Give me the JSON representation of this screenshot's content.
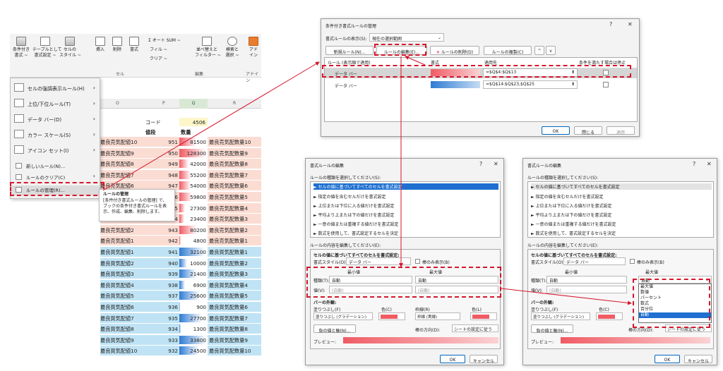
{
  "ribbon": {
    "btn_conditional": "条件付き\n書式 ~",
    "btn_table": "テーブルとして\n書式設定 ~",
    "btn_cellstyle": "セルの\nスタイル ~",
    "btn_insert": "挿入",
    "btn_delete": "削除",
    "btn_format": "書式",
    "autosum": "Σ オート SUM ~",
    "fill": "フィル ~",
    "clear": "クリア ~",
    "sort": "並べ替えと\nフィルター ~",
    "find": "検索と\n選択 ~",
    "addin": "アド\nイン",
    "group_cell": "セル",
    "group_edit": "編集",
    "group_addin": "アドイン"
  },
  "columns": [
    "O",
    "P",
    "Q",
    "R"
  ],
  "header_row": {
    "code_label": "コード",
    "code_value": "4506",
    "price_label": "値段",
    "qty_label": "数量"
  },
  "rows": [
    {
      "name": "最良売気配値10",
      "price": "951",
      "qty": "81500",
      "qty_pct": 0.62,
      "label": "最良売気配数量10",
      "side": "sell"
    },
    {
      "name": "最良売気配値9",
      "price": "950",
      "qty": "128300",
      "qty_pct": 1.0,
      "label": "最良売気配数量9",
      "side": "sell"
    },
    {
      "name": "最良売気配値8",
      "price": "949",
      "qty": "42000",
      "qty_pct": 0.33,
      "label": "最良売気配数量8",
      "side": "sell"
    },
    {
      "name": "最良売気配値7",
      "price": "948",
      "qty": "55200",
      "qty_pct": 0.43,
      "label": "最良売気配数量7",
      "side": "sell"
    },
    {
      "name": "最良売気配値6",
      "price": "947",
      "qty": "54000",
      "qty_pct": 0.42,
      "label": "最良売気配数量6",
      "side": "sell"
    },
    {
      "name": "最良売気配値5",
      "price": "946",
      "qty": "59800",
      "qty_pct": 0.47,
      "label": "最良売気配数量5",
      "side": "sell"
    },
    {
      "name": "最良売気配値4",
      "price": "945",
      "qty": "27300",
      "qty_pct": 0.21,
      "label": "最良売気配数量4",
      "side": "sell"
    },
    {
      "name": "最良売気配値3",
      "price": "944",
      "qty": "23400",
      "qty_pct": 0.18,
      "label": "最良売気配数量3",
      "side": "sell"
    },
    {
      "name": "最良売気配値2",
      "price": "943",
      "qty": "80200",
      "qty_pct": 0.63,
      "label": "最良売気配数量2",
      "side": "sell"
    },
    {
      "name": "最良売気配値1",
      "price": "942",
      "qty": "4800",
      "qty_pct": 0.04,
      "label": "最良売気配数量1",
      "side": "sell"
    },
    {
      "name": "最良買気配値1",
      "price": "941",
      "qty": "32100",
      "qty_pct": 0.96,
      "label": "最良買気配数量1",
      "side": "buy"
    },
    {
      "name": "最良買気配値2",
      "price": "940",
      "qty": "10000",
      "qty_pct": 0.3,
      "label": "最良買気配数量2",
      "side": "buy"
    },
    {
      "name": "最良買気配値3",
      "price": "939",
      "qty": "21400",
      "qty_pct": 0.64,
      "label": "最良買気配数量3",
      "side": "buy"
    },
    {
      "name": "最良買気配値4",
      "price": "938",
      "qty": "6900",
      "qty_pct": 0.2,
      "label": "最良買気配数量4",
      "side": "buy"
    },
    {
      "name": "最良買気配値5",
      "price": "937",
      "qty": "25600",
      "qty_pct": 0.77,
      "label": "最良買気配数量5",
      "side": "buy"
    },
    {
      "name": "最良買気配値6",
      "price": "936",
      "qty": "900",
      "qty_pct": 0.03,
      "label": "最良買気配数量6",
      "side": "buy"
    },
    {
      "name": "最良買気配値7",
      "price": "935",
      "qty": "27700",
      "qty_pct": 0.83,
      "label": "最良買気配数量7",
      "side": "buy"
    },
    {
      "name": "最良買気配値8",
      "price": "934",
      "qty": "1300",
      "qty_pct": 0.04,
      "label": "最良買気配数量8",
      "side": "buy"
    },
    {
      "name": "最良買気配値9",
      "price": "933",
      "qty": "33800",
      "qty_pct": 1.0,
      "label": "最良買気配数量9",
      "side": "buy"
    },
    {
      "name": "最良買気配値10",
      "price": "932",
      "qty": "24500",
      "qty_pct": 0.73,
      "label": "最良買気配数量10",
      "side": "buy"
    }
  ],
  "menu": {
    "items": [
      "セルの強調表示ルール(H)",
      "上位/下位ルール(T)",
      "データ バー(D)",
      "カラー スケール(S)",
      "アイコン セット(I)"
    ],
    "new_rule": "新しいルール(N)...",
    "clear_rule": "ルールのクリア(C)",
    "manage_rule": "ルールの管理(R)..."
  },
  "tooltip": {
    "title": "ルールの管理",
    "body": "[条件付き書式ルールの管理] で、ブックの条件付き書式ルールを表示、作成、編集、削除します。"
  },
  "manager": {
    "title": "条件付き書式ルールの管理",
    "show_label": "書式ルールの表示(S):",
    "show_value": "現在の選択範囲",
    "btn_new": "新規ルール(N)...",
    "btn_edit": "ルールの編集(E)...",
    "btn_delete": "ルールの削除(D)",
    "btn_copy": "ルールの複製(C)",
    "col_rule": "ルール (表示順で適用)",
    "col_format": "書式",
    "col_applies": "適用先",
    "col_stop": "条件を満たす場合は停止",
    "rule1_name": "データ バー",
    "rule1_range": "=$Q$4:$Q$13",
    "rule2_name": "データ バー",
    "rule2_range": "=$Q$14:$Q$23,$Q$25",
    "ok": "OK",
    "close": "閉じる",
    "apply": "適用"
  },
  "edit": {
    "title": "書式ルールの編集",
    "type_prompt": "ルールの種類を選択してください(S):",
    "types": [
      "► セルの値に基づいてすべてのセルを書式設定",
      "► 指定の値を含むセルだけを書式設定",
      "► 上位または下位に入る値だけを書式設定",
      "► 平均より上または下の値だけを書式設定",
      "► 一意の値または重複する値だけを書式設定",
      "► 数式を使用して、書式設定するセルを決定"
    ],
    "desc_prompt": "ルールの内容を編集してください(E):",
    "desc_title": "セルの値に基づいてすべてのセルを書式設定:",
    "style_label": "書式スタイル(O):",
    "style_value": "データ バー",
    "bar_only": "棒のみ表示(B)",
    "min_label": "最小値",
    "max_label": "最大値",
    "type_label": "種類(T):",
    "value_label": "値(V):",
    "auto": "自動",
    "auto_paren": "(自動)",
    "appearance": "バーの外観:",
    "fill_label": "塗りつぶし(F)",
    "color_label": "色(C)",
    "border_label": "枠線(R)",
    "color2_label": "色(L)",
    "fill_value": "塗りつぶし (グラデーション)",
    "border_value": "枠線 (実線)",
    "negative": "負の値と軸(N)...",
    "direction_label": "棒の方向(D):",
    "direction_value": "シートの設定に従う",
    "preview": "プレビュー:",
    "ok": "OK",
    "cancel": "キャンセル",
    "options": [
      "最大値",
      "数値",
      "パーセント",
      "数式",
      "百分位",
      "自動"
    ]
  },
  "colors": {
    "sell_fill": "#fbdcd2",
    "buy_fill": "#bfe3f4",
    "bar_red": "#f05b64",
    "bar_blue": "#2f7bd3",
    "highlight": "#d5162c",
    "select_blue": "#1e6fd0"
  }
}
